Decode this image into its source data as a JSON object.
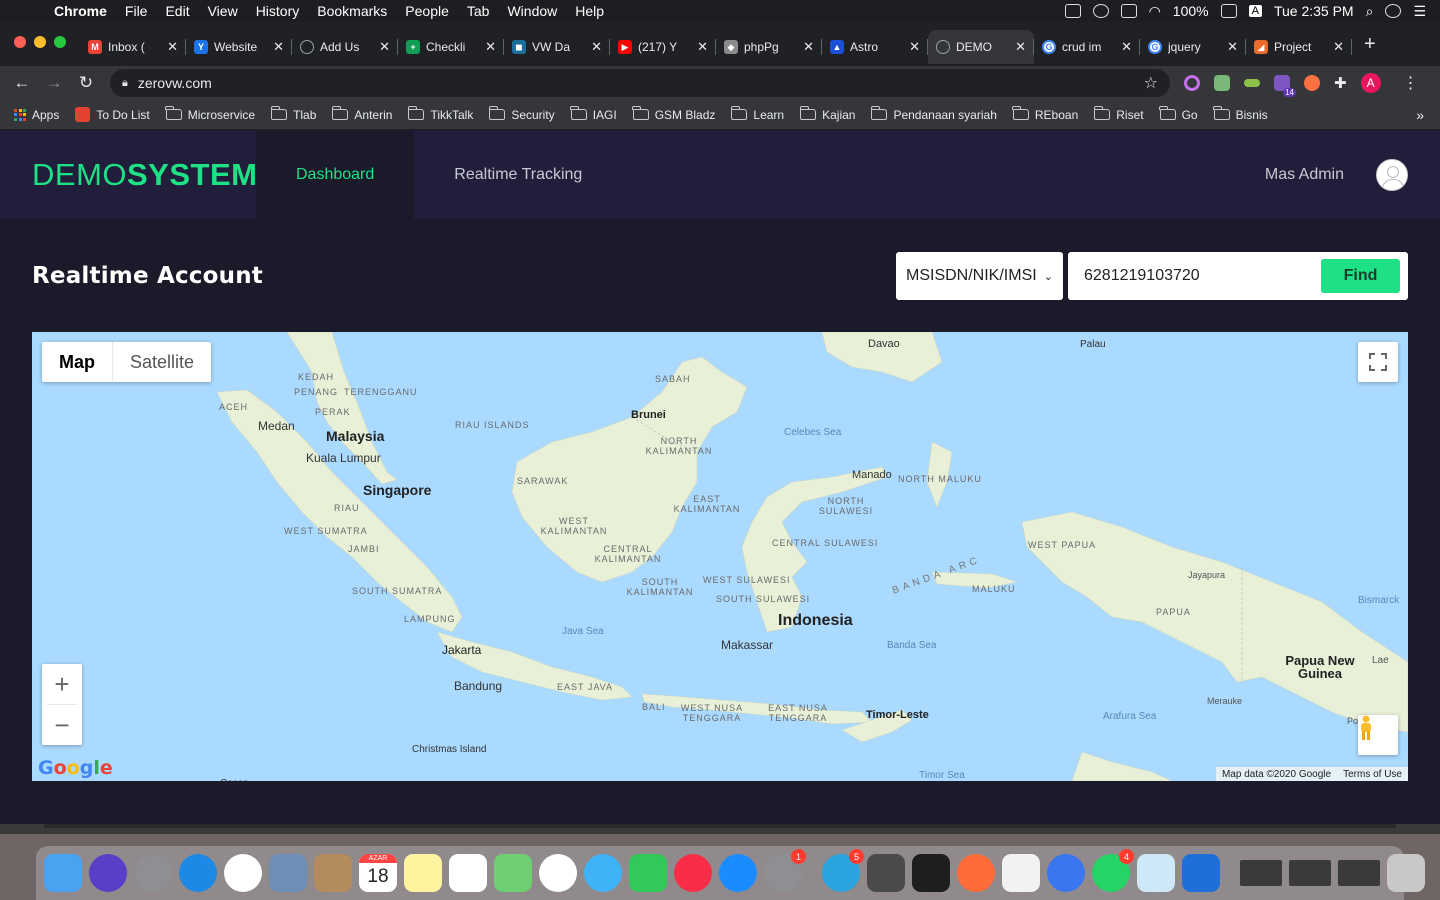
{
  "menubar": {
    "app_name": "Chrome",
    "menus": [
      "File",
      "Edit",
      "View",
      "History",
      "Bookmarks",
      "People",
      "Tab",
      "Window",
      "Help"
    ],
    "battery": "100%",
    "input_source": "A",
    "clock": "Tue 2:35 PM"
  },
  "tabs": [
    {
      "title": "Inbox (",
      "favicon": "gmail-icon",
      "color": "#ea4335",
      "glyph": "M"
    },
    {
      "title": "Website",
      "favicon": "website-icon",
      "color": "#1a73e8",
      "glyph": "Y"
    },
    {
      "title": "Add Us",
      "favicon": "globe-icon",
      "color": "#5f6368",
      "glyph": ""
    },
    {
      "title": "Checkli",
      "favicon": "sheets-icon",
      "color": "#0f9d58",
      "glyph": "+"
    },
    {
      "title": "VW Da",
      "favicon": "vw-icon",
      "color": "#1b6f9c",
      "glyph": "◼"
    },
    {
      "title": "(217) Y",
      "favicon": "youtube-icon",
      "color": "#ff0000",
      "glyph": "▶"
    },
    {
      "title": "phpPg",
      "favicon": "php-icon",
      "color": "#8a8a8a",
      "glyph": "◆"
    },
    {
      "title": "Astro",
      "favicon": "astro-icon",
      "color": "#1a4fd8",
      "glyph": "▲"
    },
    {
      "title": "DEMO",
      "favicon": "globe-icon",
      "color": "#5f6368",
      "glyph": "",
      "active": true
    },
    {
      "title": "crud im",
      "favicon": "google-icon",
      "color": "#ffffff",
      "glyph": "G"
    },
    {
      "title": "jquery",
      "favicon": "google-icon",
      "color": "#ffffff",
      "glyph": "G"
    },
    {
      "title": "Project",
      "favicon": "project-icon",
      "color": "#e96a2a",
      "glyph": "◢"
    }
  ],
  "address": {
    "url": "zerovw.com"
  },
  "extension_badge": "14",
  "profile_initial": "A",
  "bookmarks": {
    "apps_label": "Apps",
    "todo_label": "To Do List",
    "folders": [
      "Microservice",
      "Tlab",
      "Anterin",
      "TikkTalk",
      "Security",
      "IAGI",
      "GSM Bladz",
      "Learn",
      "Kajian",
      "Pendanaan syariah",
      "REboan",
      "Riset",
      "Go",
      "Bisnis"
    ]
  },
  "app": {
    "brand_light": "DEMO",
    "brand_bold": "SYSTEM",
    "nav": [
      {
        "label": "Dashboard",
        "active": true
      },
      {
        "label": "Realtime Tracking",
        "active": false
      }
    ],
    "user_name": "Mas Admin",
    "page_title": "Realtime Account",
    "search_type": "MSISDN/NIK/IMSI",
    "search_value": "6281219103720",
    "find_label": "Find",
    "accent_color": "#1ee085"
  },
  "map": {
    "type_buttons": [
      "Map",
      "Satellite"
    ],
    "zoom_in": "+",
    "zoom_out": "−",
    "logo": "Google",
    "attribution": "Map data ©2020 Google",
    "terms": "Terms of Use",
    "labels": {
      "countries": [
        "Malaysia",
        "Singapore",
        "Brunei",
        "Indonesia",
        "Timor-Leste",
        "Papua New Guinea"
      ],
      "cities": [
        "Medan",
        "Kuala Lumpur",
        "Jakarta",
        "Bandung",
        "Makassar",
        "Manado",
        "Davao",
        "Jayapura",
        "Merauke",
        "Port Moresb"
      ],
      "regions": [
        "KEDAH",
        "PENANG",
        "TERENGGANU",
        "PERAK",
        "ACEH",
        "RIAU ISLANDS",
        "SABAH",
        "NORTH KALIMANTAN",
        "SARAWAK",
        "EAST KALIMANTAN",
        "WEST KALIMANTAN",
        "CENTRAL KALIMANTAN",
        "SOUTH KALIMANTAN",
        "RIAU",
        "WEST SUMATRA",
        "JAMBI",
        "SOUTH SUMATRA",
        "LAMPUNG",
        "EAST JAVA",
        "BALI",
        "WEST NUSA TENGGARA",
        "EAST NUSA TENGGARA",
        "NORTH MALUKU",
        "NORTH SULAWESI",
        "CENTRAL SULAWESI",
        "WEST SULAWESI",
        "SOUTH SULAWESI",
        "MALUKU",
        "WEST PAPUA",
        "PAPUA"
      ],
      "seas": [
        "Celebes Sea",
        "Java Sea",
        "Banda Sea",
        "Arafura Sea",
        "Timor Sea",
        "Bismarck",
        "BANDA ARC"
      ],
      "islands": [
        "Palau",
        "Christmas Island",
        "Cocos",
        "Lae"
      ]
    }
  },
  "dock": {
    "apps": [
      "finder-icon",
      "siri-icon",
      "launchpad-icon",
      "safari-icon",
      "chrome-icon",
      "preview-icon",
      "contacts-icon",
      "calendar-icon",
      "notes-icon",
      "reminders-icon",
      "maps-icon",
      "photos-icon",
      "messages-icon",
      "facetime-icon",
      "music-icon",
      "appstore-icon",
      "preferences-icon",
      "telegram-icon",
      "sublime-icon",
      "terminal-icon",
      "postman-icon",
      "document-icon",
      "signal-icon",
      "whatsapp-icon",
      "cleaner-icon",
      "vpn-icon",
      "window-thumb-icon",
      "window-thumb-icon",
      "window-thumb-icon",
      "trash-icon"
    ],
    "calendar_month": "AZAR",
    "calendar_day": "18",
    "badges": {
      "preferences": "1",
      "telegram": "5",
      "whatsapp": "4"
    }
  }
}
